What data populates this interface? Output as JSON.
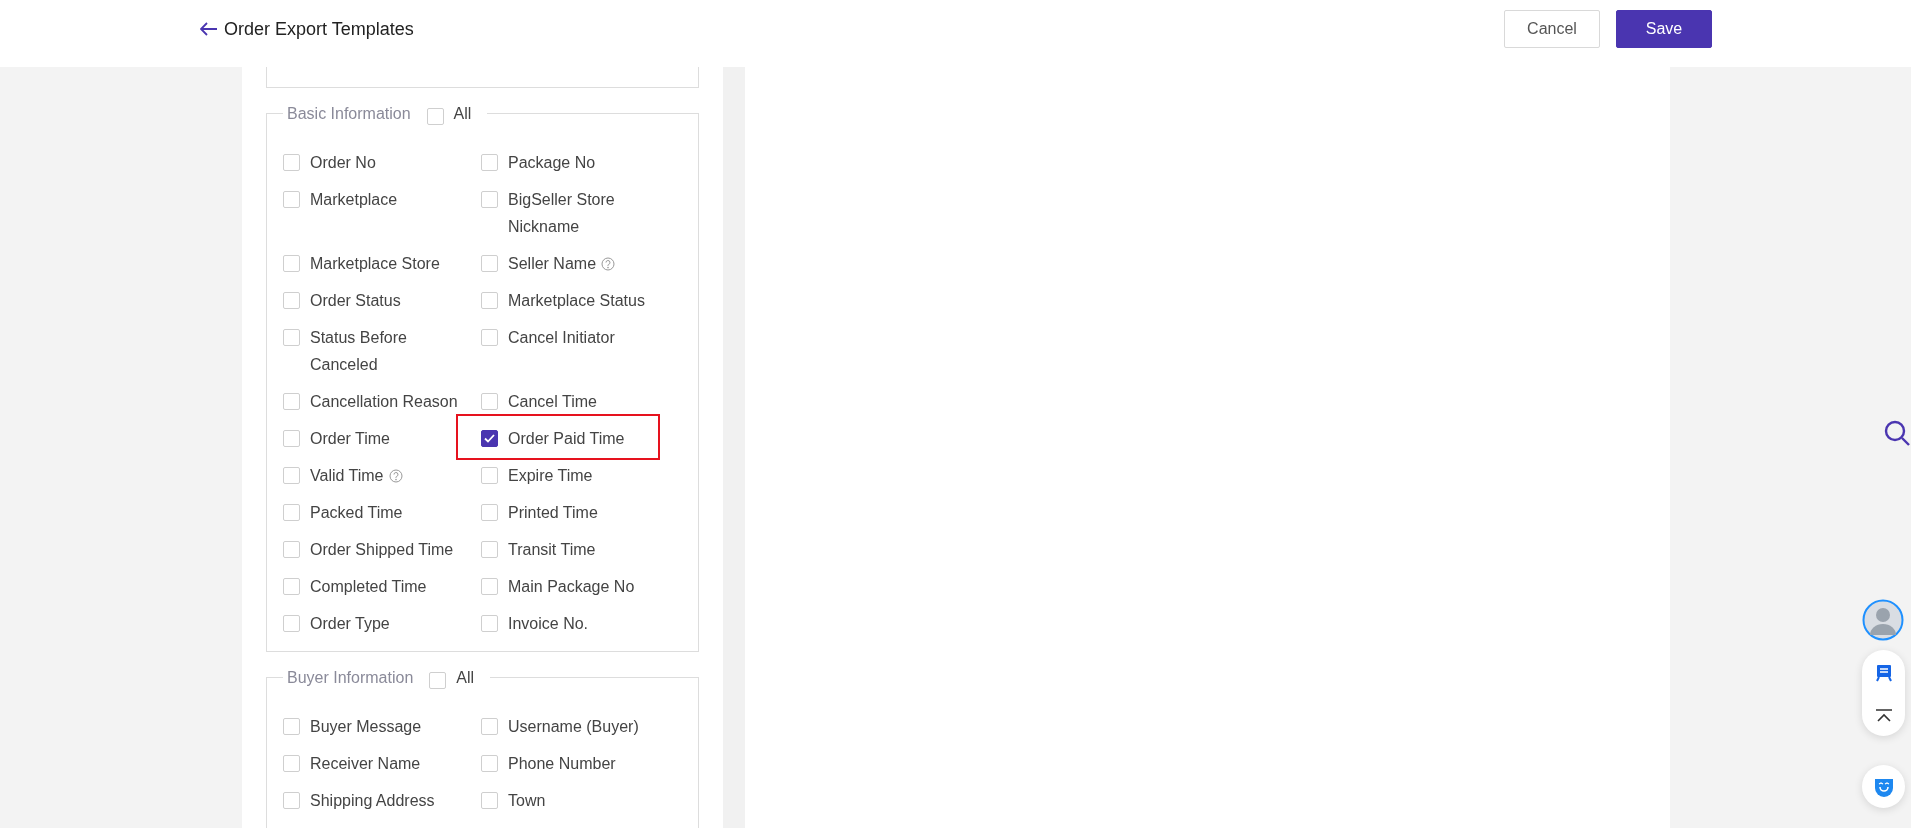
{
  "header": {
    "title": "Order Export Templates",
    "buttons": [
      {
        "label": "Cancel",
        "kind": "secondary"
      },
      {
        "label": "Save",
        "kind": "primary"
      }
    ]
  },
  "sections": [
    {
      "title": "Basic Information",
      "all_label": "All",
      "all_checked": false,
      "items": [
        {
          "label": "Order No",
          "checked": false
        },
        {
          "label": "Package No",
          "checked": false
        },
        {
          "label": "Marketplace",
          "checked": false
        },
        {
          "label": "BigSeller Store Nickname",
          "checked": false
        },
        {
          "label": "Marketplace Store",
          "checked": false
        },
        {
          "label": "Seller Name",
          "checked": false,
          "help": true
        },
        {
          "label": "Order Status",
          "checked": false
        },
        {
          "label": "Marketplace Status",
          "checked": false
        },
        {
          "label": "Status Before Canceled",
          "checked": false
        },
        {
          "label": "Cancel Initiator",
          "checked": false
        },
        {
          "label": "Cancellation Reason",
          "checked": false
        },
        {
          "label": "Cancel Time",
          "checked": false
        },
        {
          "label": "Order Time",
          "checked": false
        },
        {
          "label": "Order Paid Time",
          "checked": true,
          "highlighted": true
        },
        {
          "label": "Valid Time",
          "checked": false,
          "help": true
        },
        {
          "label": "Expire Time",
          "checked": false
        },
        {
          "label": "Packed Time",
          "checked": false
        },
        {
          "label": "Printed Time",
          "checked": false
        },
        {
          "label": "Order Shipped Time",
          "checked": false
        },
        {
          "label": "Transit Time",
          "checked": false
        },
        {
          "label": "Completed Time",
          "checked": false
        },
        {
          "label": "Main Package No",
          "checked": false
        },
        {
          "label": "Order Type",
          "checked": false
        },
        {
          "label": "Invoice No.",
          "checked": false
        }
      ]
    },
    {
      "title": "Buyer Information",
      "all_label": "All",
      "all_checked": false,
      "items": [
        {
          "label": "Buyer Message",
          "checked": false
        },
        {
          "label": "Username (Buyer)",
          "checked": false
        },
        {
          "label": "Receiver Name",
          "checked": false
        },
        {
          "label": "Phone Number",
          "checked": false
        },
        {
          "label": "Shipping Address",
          "checked": false
        },
        {
          "label": "Town",
          "checked": false
        }
      ]
    }
  ]
}
